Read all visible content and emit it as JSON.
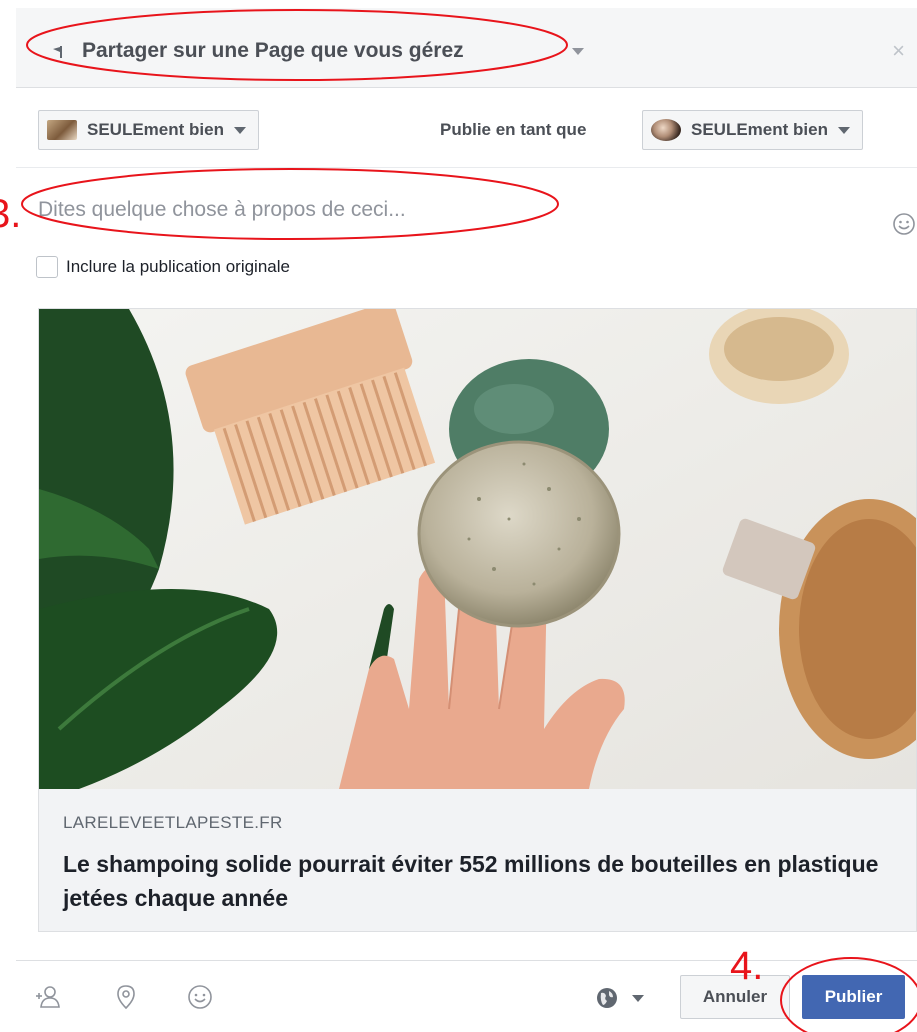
{
  "header": {
    "title": "Partager sur une Page que vous gérez",
    "flag_icon": "flag-icon",
    "close_icon": "close-icon",
    "close_glyph": "×"
  },
  "selector": {
    "page_name": "SEULEment bien",
    "publish_as_label": "Publie en tant que",
    "publish_as_name": "SEULEment bien"
  },
  "composer": {
    "placeholder": "Dites quelque chose à propos de ceci...",
    "include_original_label": "Inclure la publication originale",
    "include_original_checked": false
  },
  "link_preview": {
    "domain": "LARELEVEETLAPESTE.FR",
    "headline": "Le shampoing solide pourrait éviter 552 millions de bouteilles en plastique jetées chaque année"
  },
  "footer": {
    "cancel_label": "Annuler",
    "publish_label": "Publier",
    "audience_icon": "globe-icon"
  },
  "annotations": {
    "step_3": "3.",
    "step_4": "4.",
    "color": "#e8141b"
  },
  "colors": {
    "accent": "#4267b2",
    "header_bg": "#f5f6f7",
    "annotation": "#e8141b"
  }
}
